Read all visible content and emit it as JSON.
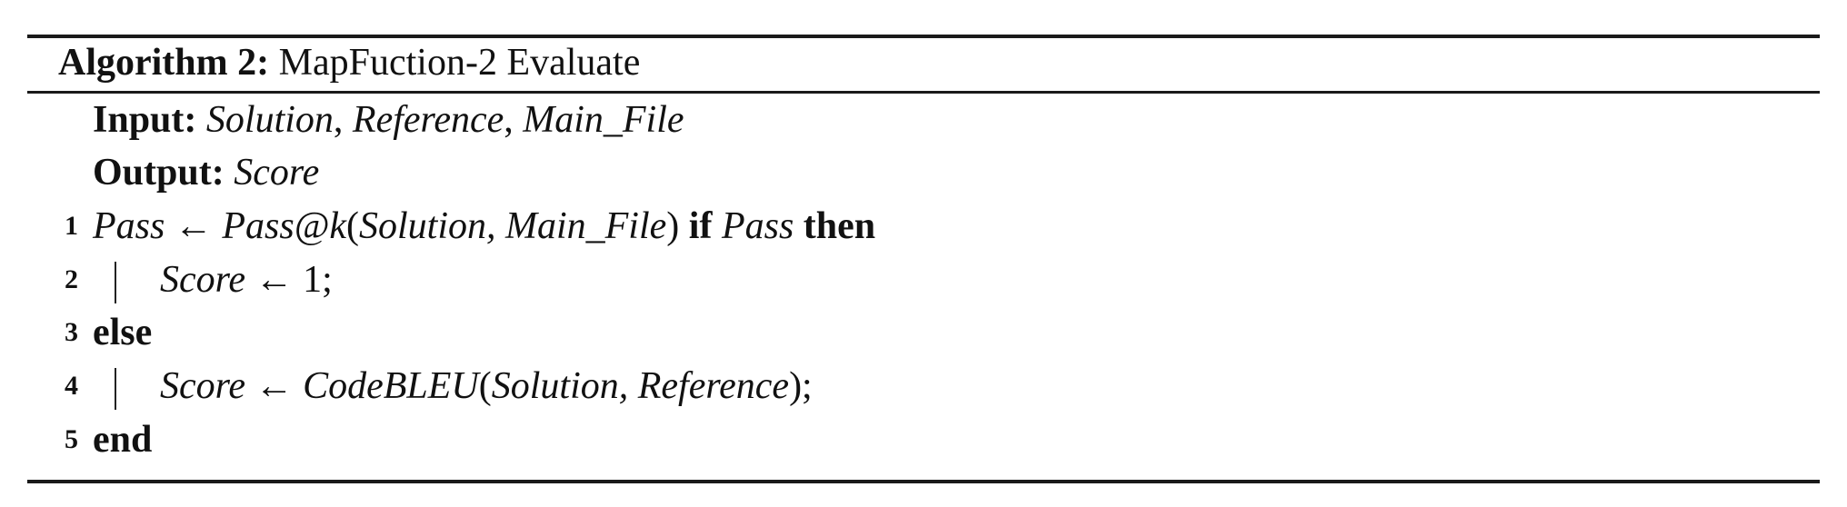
{
  "algorithm": {
    "label": "Algorithm 2:",
    "title": "MapFuction-2 Evaluate",
    "input_label": "Input:",
    "inputs": [
      "Solution",
      "Reference",
      "Main_File"
    ],
    "output_label": "Output:",
    "output": "Score",
    "lines": [
      {
        "no": "1",
        "lhs": "Pass",
        "arrow": "←",
        "call": "Pass@k",
        "args": "Solution, Main_File",
        "if_kw": "if",
        "cond": "Pass",
        "then_kw": "then"
      },
      {
        "no": "2",
        "lhs": "Score",
        "arrow": "←",
        "value": "1;"
      },
      {
        "no": "3",
        "kw": "else"
      },
      {
        "no": "4",
        "lhs": "Score",
        "arrow": "←",
        "call": "CodeBLEU",
        "args": "Solution, Reference",
        "tail": ");"
      },
      {
        "no": "5",
        "kw": "end"
      }
    ]
  }
}
